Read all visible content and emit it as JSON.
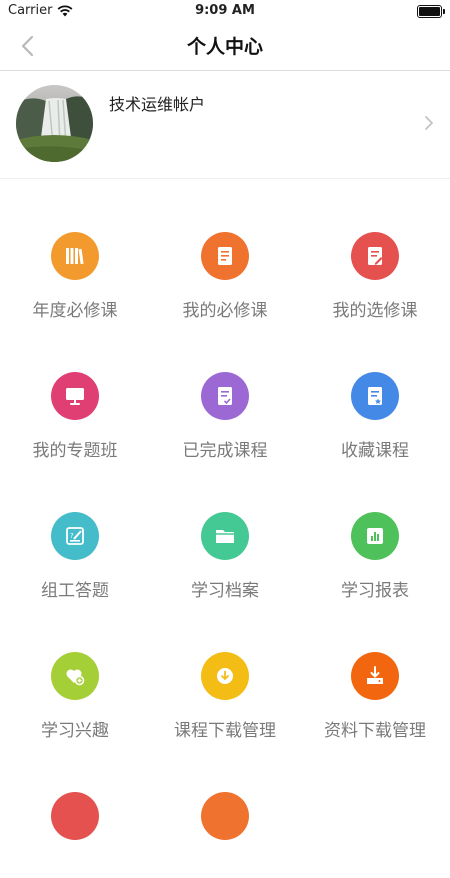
{
  "status_bar": {
    "carrier": "Carrier",
    "time": "9:09 AM"
  },
  "nav": {
    "title": "个人中心",
    "back_icon": "chevron-left-icon"
  },
  "profile": {
    "name": "技术运维帐户",
    "avatar": "waterfall-landscape-photo"
  },
  "grid": [
    {
      "label": "年度必修课",
      "icon": "books-icon",
      "color": "#f39a2e"
    },
    {
      "label": "我的必修课",
      "icon": "document-icon",
      "color": "#f0722f"
    },
    {
      "label": "我的选修课",
      "icon": "document-edit-icon",
      "color": "#e4514f"
    },
    {
      "label": "我的专题班",
      "icon": "monitor-icon",
      "color": "#df3f73"
    },
    {
      "label": "已完成课程",
      "icon": "document-check-icon",
      "color": "#9b68d4"
    },
    {
      "label": "收藏课程",
      "icon": "document-star-icon",
      "color": "#4489e6"
    },
    {
      "label": "组工答题",
      "icon": "answer-edit-icon",
      "color": "#45bcc9"
    },
    {
      "label": "学习档案",
      "icon": "folder-icon",
      "color": "#45c994"
    },
    {
      "label": "学习报表",
      "icon": "bar-chart-icon",
      "color": "#4fc15b"
    },
    {
      "label": "学习兴趣",
      "icon": "heart-add-icon",
      "color": "#a4cf36"
    },
    {
      "label": "课程下载管理",
      "icon": "download-circle-icon",
      "color": "#f3bd16"
    },
    {
      "label": "资料下载管理",
      "icon": "download-tray-icon",
      "color": "#f1660f"
    },
    {
      "label": "",
      "icon": "partial-icon",
      "color": "#e4514f"
    },
    {
      "label": "",
      "icon": "partial-icon",
      "color": "#f0722f"
    }
  ]
}
